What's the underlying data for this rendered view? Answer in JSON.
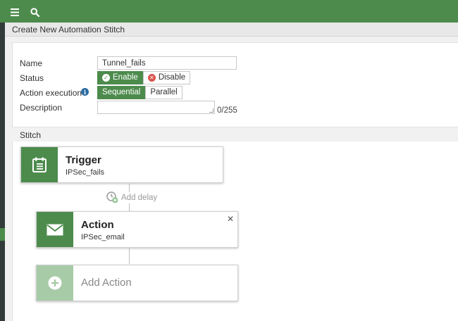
{
  "topbar": {
    "menu_icon": "hamburger-menu-icon",
    "search_icon": "search-icon",
    "color": "#4c8b4c"
  },
  "page": {
    "title": "Create New Automation Stitch"
  },
  "form": {
    "name_label": "Name",
    "name_value": "Tunnel_fails",
    "status_label": "Status",
    "status_enable": "Enable",
    "status_disable": "Disable",
    "status_selected": "Enable",
    "action_execution_label": "Action execution",
    "exec_sequential": "Sequential",
    "exec_parallel": "Parallel",
    "exec_selected": "Sequential",
    "description_label": "Description",
    "description_value": "",
    "description_counter": "0/255"
  },
  "stitch": {
    "section_title": "Stitch",
    "trigger": {
      "title": "Trigger",
      "subtitle": "IPSec_fails",
      "icon": "calendar-list-icon"
    },
    "add_delay_label": "Add delay",
    "action": {
      "title": "Action",
      "subtitle": "IPSec_email",
      "icon": "envelope-icon"
    },
    "add_action_label": "Add Action"
  }
}
